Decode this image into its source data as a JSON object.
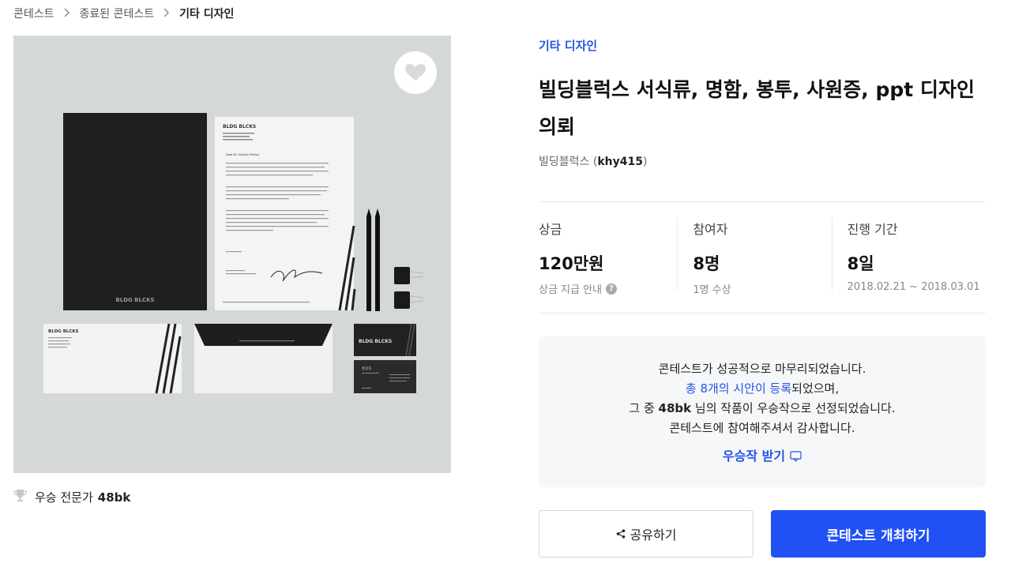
{
  "breadcrumb": {
    "items": [
      "콘테스트",
      "종료된 콘테스트",
      "기타 디자인"
    ]
  },
  "artwork": {
    "brand_text": "BLDG BLCKS",
    "letter_greeting": "Dear Mr. Daniels Phillips",
    "card_name": "홍길동"
  },
  "winner": {
    "label": "우승 전문가",
    "name": "48bk"
  },
  "contest": {
    "category": "기타 디자인",
    "title": "빌딩블럭스 서식류, 명함, 봉투, 사원증, ppt 디자인 의뢰",
    "host_name": "빌딩블럭스",
    "host_id": "khy415"
  },
  "stats": {
    "prize": {
      "label": "상금",
      "value": "120만원",
      "sub": "상금 지급 안내"
    },
    "participants": {
      "label": "참여자",
      "value": "8명",
      "sub": "1명 수상"
    },
    "period": {
      "label": "진행 기간",
      "value": "8일",
      "sub": "2018.02.21 ~ 2018.03.01"
    }
  },
  "result": {
    "line1": "콘테스트가 성공적으로 마무리되었습니다.",
    "line2_link": "총 8개의 시안이 등록",
    "line2_rest": "되었으며,",
    "line3_pre": "그 중",
    "line3_name": "48bk",
    "line3_rest": "님의 작품이 우승작으로 선정되었습니다.",
    "line4": "콘테스트에 참여해주셔서 감사합니다.",
    "winner_link": "우승작 받기"
  },
  "buttons": {
    "share": "공유하기",
    "host_contest": "콘테스트 개최하기"
  },
  "colors": {
    "accent": "#2151f5",
    "link": "#2454e8",
    "panel_bg": "#f6f7f9"
  },
  "icons": [
    "chevron-right-icon",
    "heart-icon",
    "trophy-icon",
    "help-icon",
    "download-icon",
    "share-icon"
  ]
}
